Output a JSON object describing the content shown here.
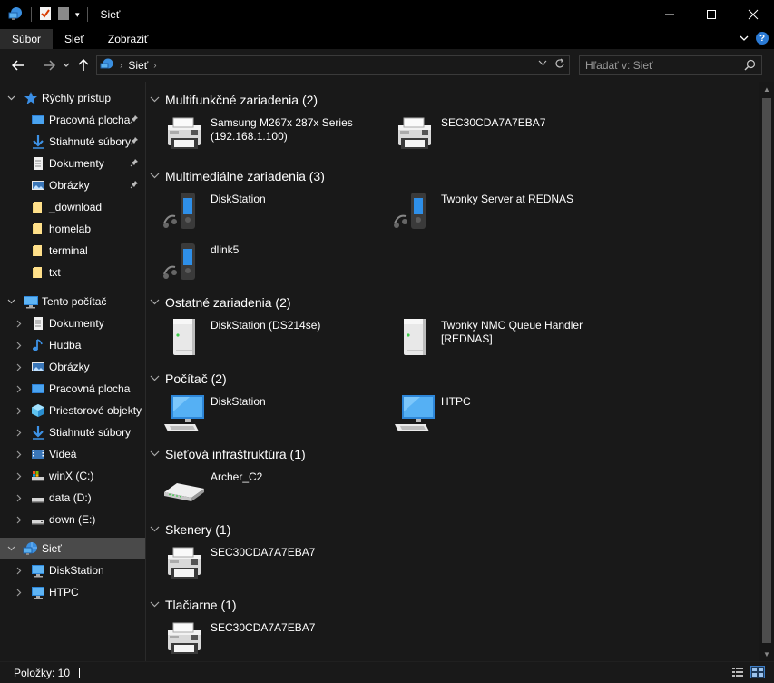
{
  "window": {
    "title": "Sieť",
    "controls": {
      "minimize": "—",
      "maximize": "☐",
      "close": "✕"
    }
  },
  "ribbon": {
    "tabs": [
      {
        "label": "Súbor",
        "active": true
      },
      {
        "label": "Sieť",
        "active": false
      },
      {
        "label": "Zobraziť",
        "active": false
      }
    ],
    "help": "?"
  },
  "address": {
    "crumb": "Sieť",
    "search_placeholder": "Hľadať v: Sieť"
  },
  "nav": {
    "quick_access": {
      "label": "Rýchly prístup",
      "items": [
        {
          "label": "Pracovná plocha",
          "icon": "desktop-icon",
          "pinned": true
        },
        {
          "label": "Stiahnuté súbory",
          "icon": "downloads-icon",
          "pinned": true
        },
        {
          "label": "Dokumenty",
          "icon": "documents-icon",
          "pinned": true
        },
        {
          "label": "Obrázky",
          "icon": "pictures-icon",
          "pinned": true
        },
        {
          "label": "_download",
          "icon": "folder-icon",
          "pinned": false
        },
        {
          "label": "homelab",
          "icon": "folder-icon",
          "pinned": false
        },
        {
          "label": "terminal",
          "icon": "folder-icon",
          "pinned": false
        },
        {
          "label": "txt",
          "icon": "folder-icon",
          "pinned": false
        }
      ]
    },
    "this_pc": {
      "label": "Tento počítač",
      "items": [
        {
          "label": "Dokumenty",
          "icon": "documents-icon"
        },
        {
          "label": "Hudba",
          "icon": "music-icon"
        },
        {
          "label": "Obrázky",
          "icon": "pictures-icon"
        },
        {
          "label": "Pracovná plocha",
          "icon": "desktop-icon"
        },
        {
          "label": "Priestorové objekty",
          "icon": "3d-objects-icon"
        },
        {
          "label": "Stiahnuté súbory",
          "icon": "downloads-icon"
        },
        {
          "label": "Videá",
          "icon": "videos-icon"
        },
        {
          "label": "winX (C:)",
          "icon": "system-drive-icon"
        },
        {
          "label": "data (D:)",
          "icon": "drive-icon"
        },
        {
          "label": "down (E:)",
          "icon": "drive-icon"
        }
      ]
    },
    "network": {
      "label": "Sieť",
      "items": [
        {
          "label": "DiskStation",
          "icon": "computer-icon"
        },
        {
          "label": "HTPC",
          "icon": "computer-icon"
        }
      ]
    }
  },
  "groups": [
    {
      "title": "Multifunkčné zariadenia (2)",
      "items": [
        {
          "name": "Samsung M267x 287x Series",
          "sub": "(192.168.1.100)",
          "icon": "printer"
        },
        {
          "name": "SEC30CDA7A7EBA7",
          "sub": "",
          "icon": "printer"
        }
      ]
    },
    {
      "title": "Multimediálne zariadenia (3)",
      "items": [
        {
          "name": "DiskStation",
          "sub": "",
          "icon": "media"
        },
        {
          "name": "Twonky Server at REDNAS",
          "sub": "",
          "icon": "media"
        },
        {
          "name": "dlink5",
          "sub": "",
          "icon": "media"
        }
      ]
    },
    {
      "title": "Ostatné zariadenia (2)",
      "items": [
        {
          "name": "DiskStation (DS214se)",
          "sub": "",
          "icon": "server"
        },
        {
          "name": "Twonky NMC Queue Handler",
          "sub": "[REDNAS]",
          "icon": "server"
        }
      ]
    },
    {
      "title": "Počítač (2)",
      "items": [
        {
          "name": "DiskStation",
          "sub": "",
          "icon": "computer"
        },
        {
          "name": "HTPC",
          "sub": "",
          "icon": "computer"
        }
      ]
    },
    {
      "title": "Sieťová infraštruktúra (1)",
      "items": [
        {
          "name": "Archer_C2",
          "sub": "",
          "icon": "router"
        }
      ]
    },
    {
      "title": "Skenery (1)",
      "items": [
        {
          "name": "SEC30CDA7A7EBA7",
          "sub": "",
          "icon": "printer"
        }
      ]
    },
    {
      "title": "Tlačiarne (1)",
      "items": [
        {
          "name": "SEC30CDA7A7EBA7",
          "sub": "",
          "icon": "printer"
        }
      ]
    }
  ],
  "status": {
    "text": "Položky: 10"
  }
}
